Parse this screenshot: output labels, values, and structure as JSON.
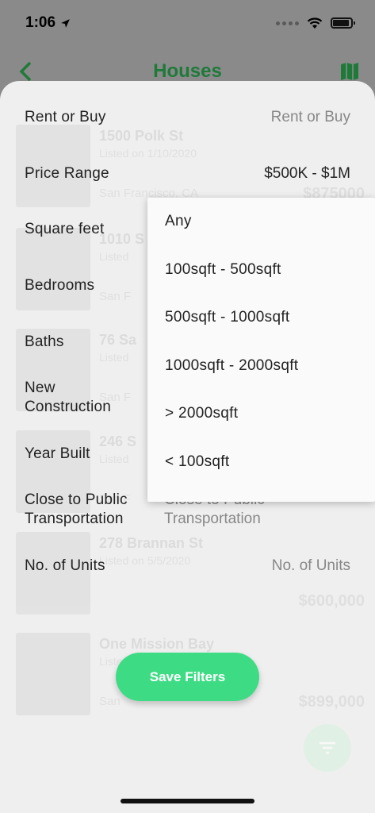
{
  "status": {
    "time": "1:06"
  },
  "nav": {
    "title": "Houses"
  },
  "listings": [
    {
      "address": "1500 Polk St",
      "listed": "Listed on 1/10/2020",
      "city": "San Francisco, CA",
      "price": "$875000"
    },
    {
      "address": "1010 S",
      "listed": "Listed",
      "city": "San F",
      "price": ""
    },
    {
      "address": "76 Sa",
      "listed": "Listed",
      "city": "San F",
      "price": ""
    },
    {
      "address": "246 S",
      "listed": "Listed",
      "city": "San F",
      "price": ""
    },
    {
      "address": "278 Brannan St",
      "listed": "Listed on 5/5/2020",
      "city": "",
      "price": "$600,000"
    },
    {
      "address": "One Mission Bay",
      "listed": "Listed",
      "city": "San",
      "price": "$899,000"
    }
  ],
  "filters": [
    {
      "label": "Rent or Buy",
      "value": "Rent or Buy"
    },
    {
      "label": "Price Range",
      "value": "$500K - $1M"
    },
    {
      "label": "Square feet",
      "value": ""
    },
    {
      "label": "Bedrooms",
      "value": ""
    },
    {
      "label": "Baths",
      "value": ""
    },
    {
      "label": "New\nConstruction",
      "value": ""
    },
    {
      "label": "Year Built",
      "value": ""
    },
    {
      "label": "Close to Public\nTransportation",
      "value": "Close to Public\nTransportation"
    },
    {
      "label": "No. of Units",
      "value": "No. of Units"
    }
  ],
  "dropdown": {
    "options": [
      "Any",
      "100sqft - 500sqft",
      "500sqft - 1000sqft",
      "1000sqft - 2000sqft",
      "> 2000sqft",
      "< 100sqft"
    ]
  },
  "save_button": {
    "label": "Save Filters"
  },
  "colors": {
    "accent": "#3ddc84",
    "nav_green": "#1f7a3a"
  }
}
